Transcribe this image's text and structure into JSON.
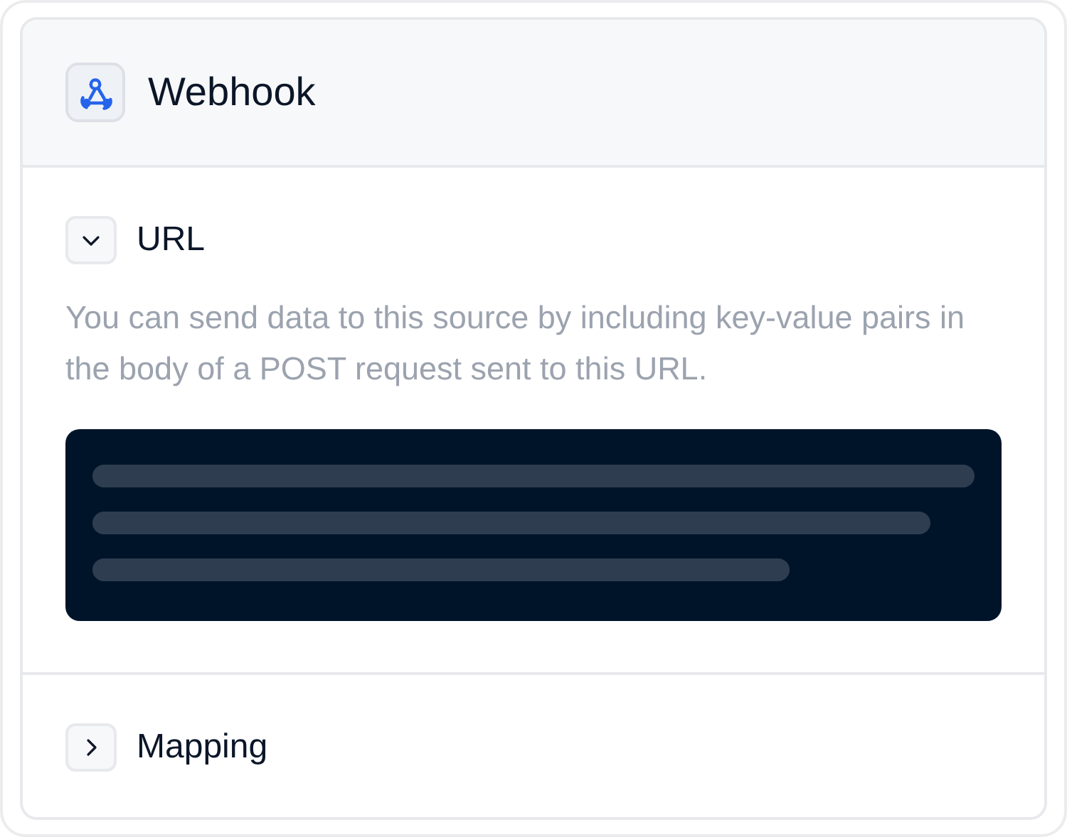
{
  "header": {
    "title": "Webhook"
  },
  "sections": [
    {
      "title": "URL",
      "expanded": true,
      "description": "You can send data to this source by including key-value pairs in the body of a POST request sent to this URL."
    },
    {
      "title": "Mapping",
      "expanded": false
    }
  ]
}
